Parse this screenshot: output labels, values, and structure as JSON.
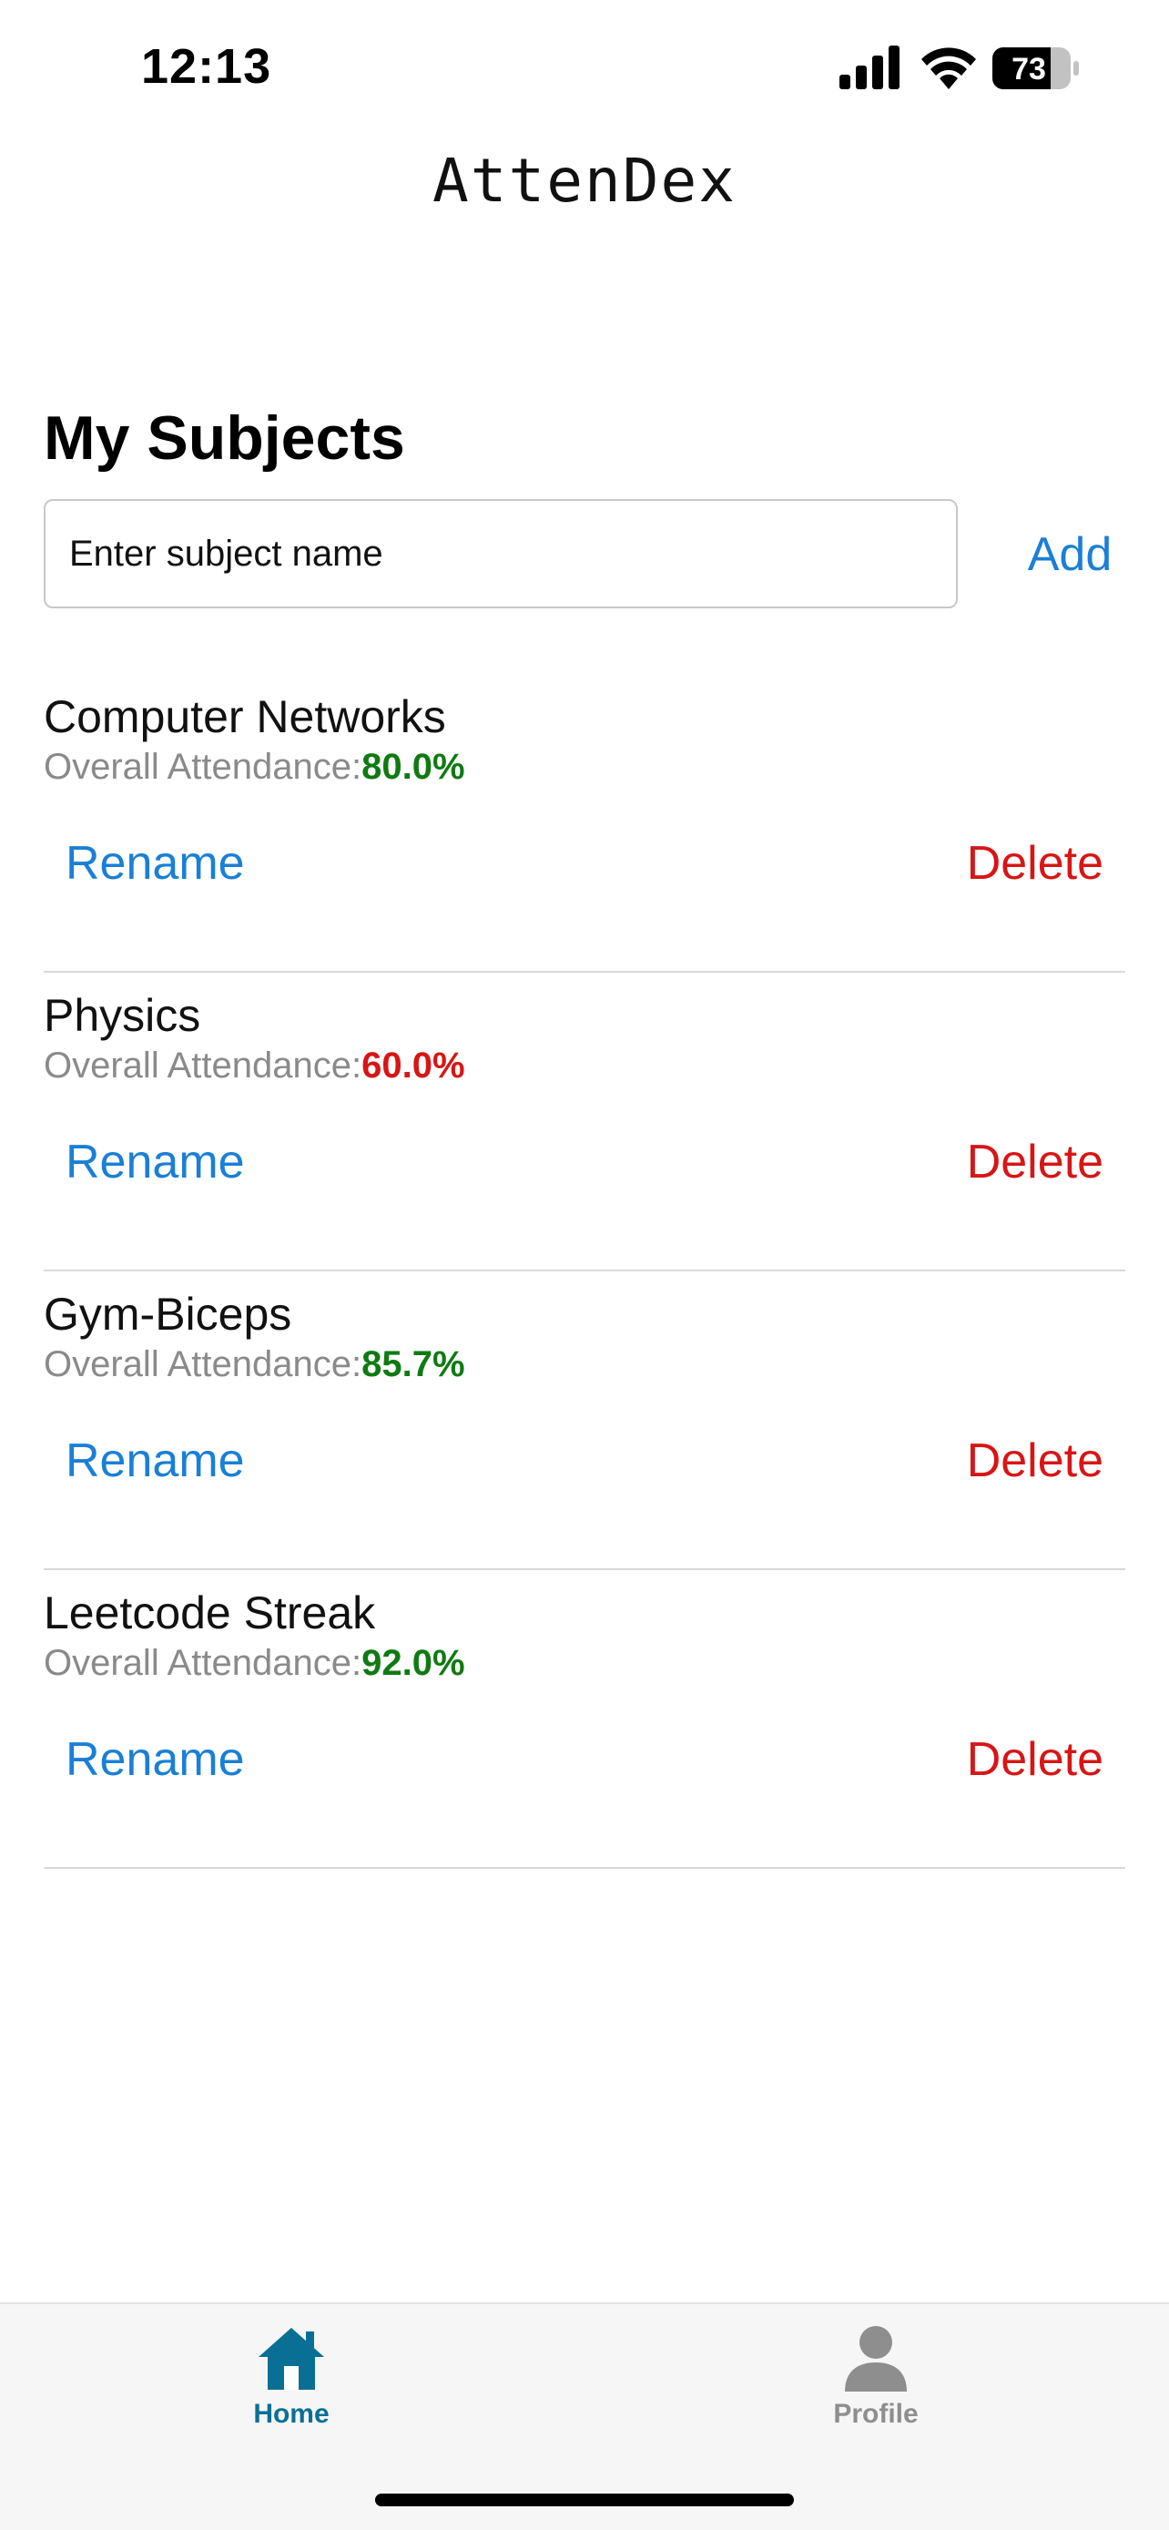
{
  "status_bar": {
    "time": "12:13",
    "battery": "73",
    "icons": [
      "signal-icon",
      "wifi-icon",
      "battery-icon"
    ]
  },
  "app_title": "AttenDex",
  "section_title": "My Subjects",
  "add_subject": {
    "placeholder": "Enter subject name",
    "value": "",
    "add_label": "Add"
  },
  "subjects": [
    {
      "name": "Computer Networks",
      "attendance_label": "Overall Attendance:",
      "attendance_value": "80.0%",
      "attendance_color": "#0f7a12",
      "rename_label": "Rename",
      "delete_label": "Delete"
    },
    {
      "name": "Physics",
      "attendance_label": "Overall Attendance:",
      "attendance_value": "60.0%",
      "attendance_color": "#d81515",
      "rename_label": "Rename",
      "delete_label": "Delete"
    },
    {
      "name": "Gym-Biceps",
      "attendance_label": "Overall Attendance:",
      "attendance_value": "85.7%",
      "attendance_color": "#0f7a12",
      "rename_label": "Rename",
      "delete_label": "Delete"
    },
    {
      "name": "Leetcode Streak",
      "attendance_label": "Overall Attendance:",
      "attendance_value": "92.0%",
      "attendance_color": "#0f7a12",
      "rename_label": "Rename",
      "delete_label": "Delete"
    }
  ],
  "tab_bar": {
    "tabs": [
      {
        "label": "Home",
        "icon": "home-icon",
        "active": true
      },
      {
        "label": "Profile",
        "icon": "person-icon",
        "active": false
      }
    ]
  },
  "colors": {
    "accent_blue": "#1a7fd6",
    "delete_red": "#d81515",
    "good_green": "#0f7a12",
    "active_tab": "#0a6f95",
    "inactive_tab": "#8e8e8e"
  }
}
